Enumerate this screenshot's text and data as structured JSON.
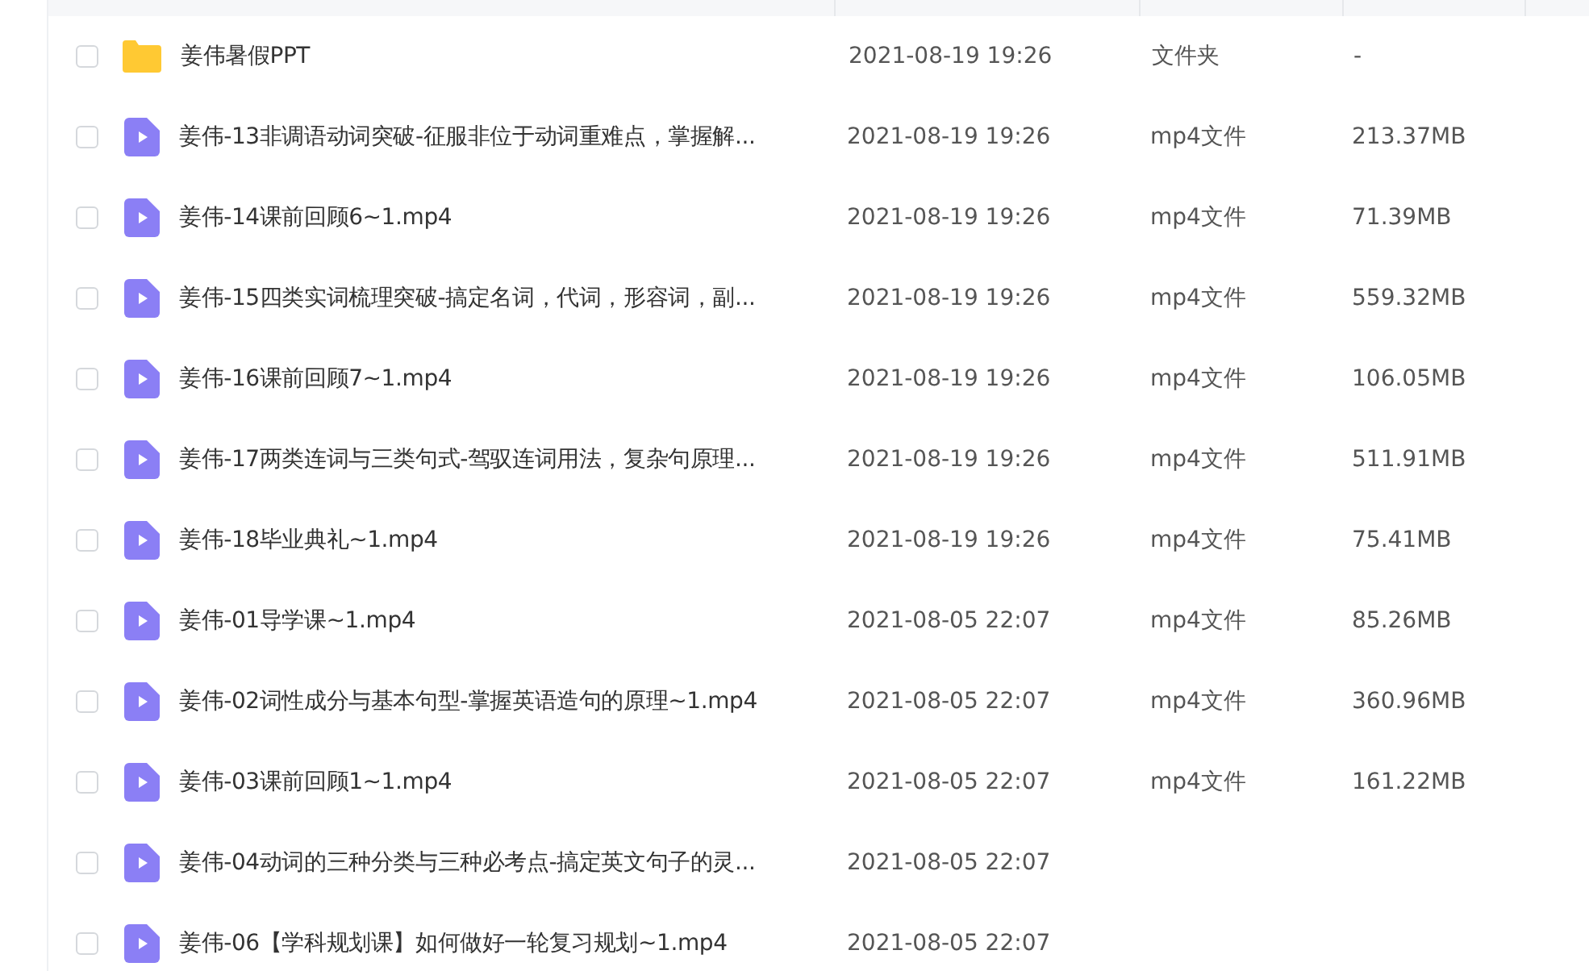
{
  "files": [
    {
      "kind": "folder",
      "checked": false,
      "name": "姜伟暑假PPT",
      "modified": "2021-08-19 19:26",
      "type": "文件夹",
      "size": "-"
    },
    {
      "kind": "video",
      "checked": false,
      "name": "姜伟-13非调语动词突破-征服非位于动词重难点，掌握解...",
      "modified": "2021-08-19 19:26",
      "type": "mp4文件",
      "size": "213.37MB"
    },
    {
      "kind": "video",
      "checked": false,
      "name": "姜伟-14课前回顾6~1.mp4",
      "modified": "2021-08-19 19:26",
      "type": "mp4文件",
      "size": "71.39MB"
    },
    {
      "kind": "video",
      "checked": false,
      "name": "姜伟-15四类实词梳理突破-搞定名词，代词，形容词，副...",
      "modified": "2021-08-19 19:26",
      "type": "mp4文件",
      "size": "559.32MB"
    },
    {
      "kind": "video",
      "checked": false,
      "name": "姜伟-16课前回顾7~1.mp4",
      "modified": "2021-08-19 19:26",
      "type": "mp4文件",
      "size": "106.05MB"
    },
    {
      "kind": "video",
      "checked": false,
      "name": "姜伟-17两类连词与三类句式-驾驭连词用法，复杂句原理...",
      "modified": "2021-08-19 19:26",
      "type": "mp4文件",
      "size": "511.91MB"
    },
    {
      "kind": "video",
      "checked": false,
      "name": "姜伟-18毕业典礼~1.mp4",
      "modified": "2021-08-19 19:26",
      "type": "mp4文件",
      "size": "75.41MB"
    },
    {
      "kind": "video",
      "checked": false,
      "name": "姜伟-01导学课~1.mp4",
      "modified": "2021-08-05 22:07",
      "type": "mp4文件",
      "size": "85.26MB"
    },
    {
      "kind": "video",
      "checked": false,
      "name": "姜伟-02词性成分与基本句型-掌握英语造句的原理~1.mp4",
      "modified": "2021-08-05 22:07",
      "type": "mp4文件",
      "size": "360.96MB"
    },
    {
      "kind": "video",
      "checked": false,
      "name": "姜伟-03课前回顾1~1.mp4",
      "modified": "2021-08-05 22:07",
      "type": "mp4文件",
      "size": "161.22MB"
    },
    {
      "kind": "video",
      "checked": false,
      "name": "姜伟-04动词的三种分类与三种必考点-搞定英文句子的灵...",
      "modified": "2021-08-05 22:07"
    },
    {
      "kind": "video",
      "checked": false,
      "name": "姜伟-06【学科规划课】如何做好一轮复习规划~1.mp4",
      "modified": "2021-08-05 22:07"
    }
  ]
}
